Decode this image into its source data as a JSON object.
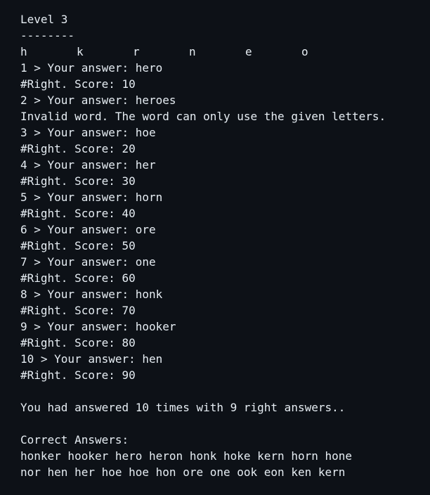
{
  "level_title": "Level 3",
  "divider": "--------",
  "letters": [
    "h",
    "k",
    "r",
    "n",
    "e",
    "o"
  ],
  "entries": [
    {
      "prompt": "1 > Your answer: hero",
      "result": "#Right. Score: 10"
    },
    {
      "prompt": "2 > Your answer: heroes",
      "result": "Invalid word. The word can only use the given letters."
    },
    {
      "prompt": "3 > Your answer: hoe",
      "result": "#Right. Score: 20"
    },
    {
      "prompt": "4 > Your answer: her",
      "result": "#Right. Score: 30"
    },
    {
      "prompt": "5 > Your answer: horn",
      "result": "#Right. Score: 40"
    },
    {
      "prompt": "6 > Your answer: ore",
      "result": "#Right. Score: 50"
    },
    {
      "prompt": "7 > Your answer: one",
      "result": "#Right. Score: 60"
    },
    {
      "prompt": "8 > Your answer: honk",
      "result": "#Right. Score: 70"
    },
    {
      "prompt": "9 > Your answer: hooker",
      "result": "#Right. Score: 80"
    },
    {
      "prompt": "10 > Your answer: hen",
      "result": "#Right. Score: 90"
    }
  ],
  "summary": "You had answered 10 times with 9 right answers..",
  "correct_answers_heading": "Correct Answers:",
  "correct_answers_lines": [
    "honker hooker hero heron honk hoke kern horn hone",
    "nor hen her hoe hoe hon ore one ook eon ken kern"
  ]
}
